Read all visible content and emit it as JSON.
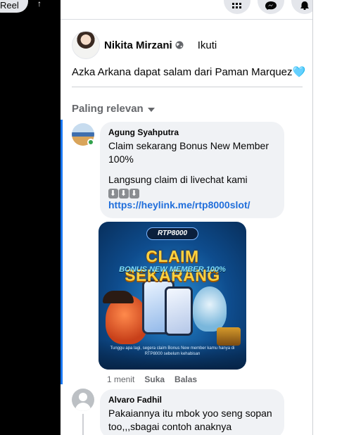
{
  "top": {
    "reel_label": "Reel",
    "left_glyph": "↑"
  },
  "post": {
    "author": "Nikita Mirzani",
    "follow_label": "Ikuti",
    "text": "Azka Arkana dapat salam dari Paman Marquez",
    "text_emoji": "🩵"
  },
  "sort": {
    "label": "Paling relevan"
  },
  "comments": [
    {
      "author": "Agung Syahputra",
      "text_line1": "Claim sekarang Bonus New Member 100%",
      "text_line2": "Langsung claim di livechat kami",
      "arrows": [
        "⬇",
        "⬇",
        "⬇"
      ],
      "link": "https://heylink.me/rtp8000slot/",
      "image": {
        "logo": "RTP8000",
        "headline": "CLAIM SEKARANG",
        "subline": "BONUS NEW MEMBER 100%",
        "fineprint": "Tunggu apa lagi, segera claim Bonus New member kamu hanya di RTP8000 sebelum kehabisan"
      },
      "time": "1 menit",
      "like_label": "Suka",
      "reply_label": "Balas"
    },
    {
      "author": "Alvaro Fadhil",
      "text": "Pakaiannya itu mbok yoo seng sopan too,,,sbagai contoh anaknya"
    }
  ],
  "colors": {
    "link": "#216fdb",
    "highlight": "#1877f2",
    "bubble": "#f0f2f5",
    "online": "#31a24c"
  },
  "icons": [
    "menu-grid-icon",
    "messenger-icon",
    "bell-icon",
    "globe-icon",
    "chevron-down-icon"
  ]
}
